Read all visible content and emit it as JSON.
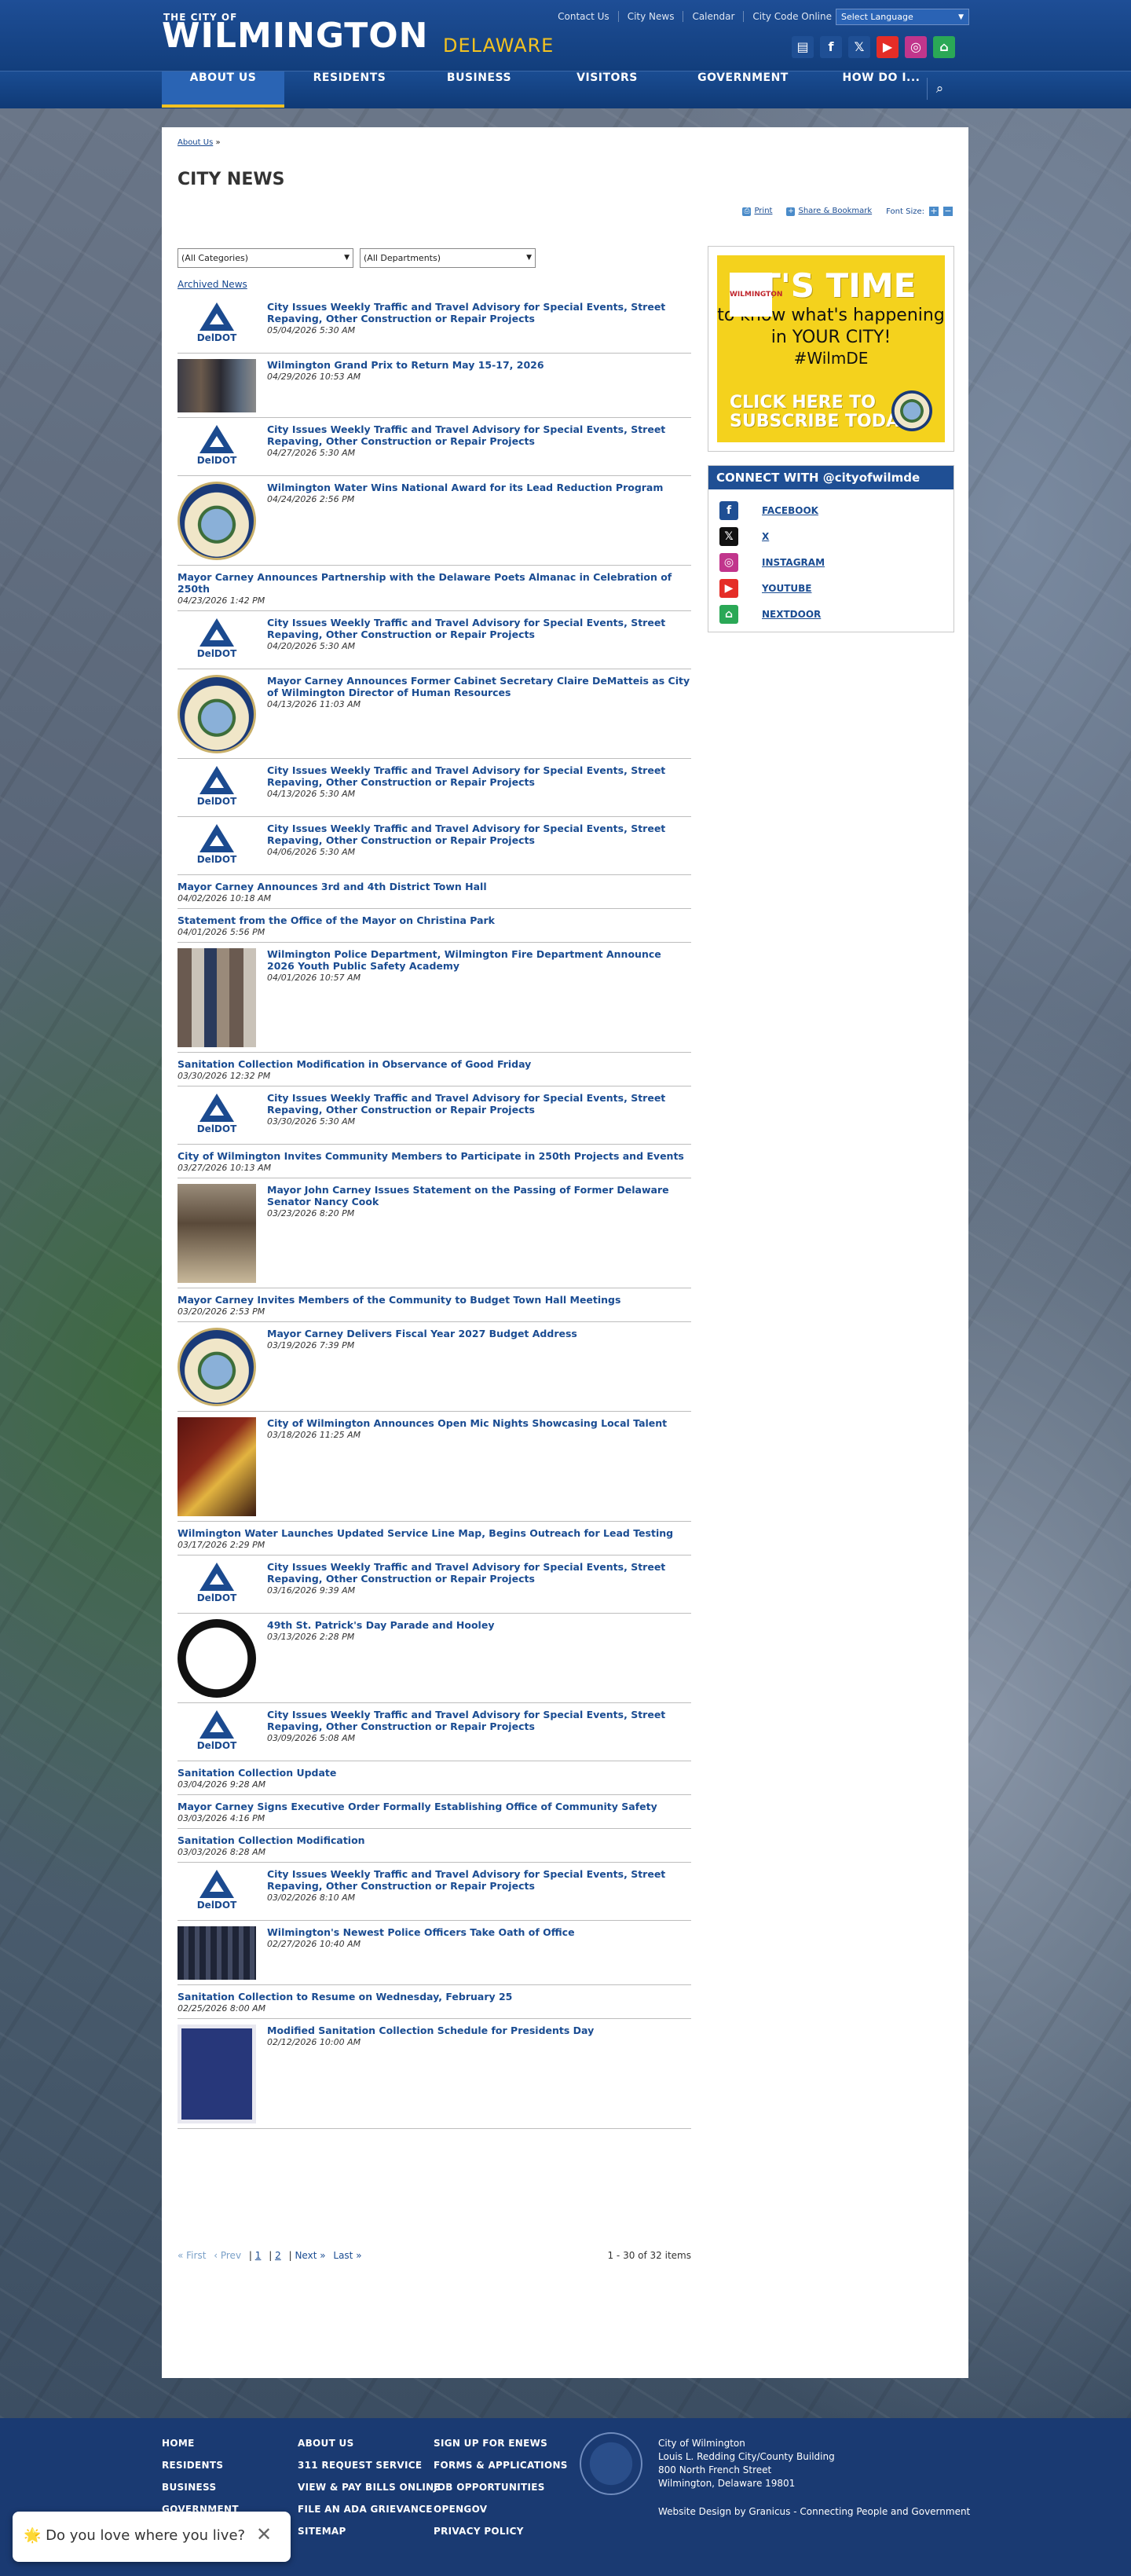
{
  "header": {
    "logo_small": "THE CITY OF",
    "logo_big": "WILMINGTON",
    "logo_state": "DELAWARE",
    "top_links": [
      "Contact Us",
      "City News",
      "Calendar",
      "City Code Online"
    ],
    "language": "Select Language",
    "social": [
      {
        "name": "news-icon",
        "glyph": "▤",
        "color": "#1f4f94"
      },
      {
        "name": "facebook-icon",
        "glyph": "f",
        "color": "#1f4f94"
      },
      {
        "name": "x-icon",
        "glyph": "𝕏",
        "color": "#1f4f94"
      },
      {
        "name": "youtube-icon",
        "glyph": "▶",
        "color": "#e52d27"
      },
      {
        "name": "instagram-icon",
        "glyph": "◎",
        "color": "#c1358c"
      },
      {
        "name": "nextdoor-icon",
        "glyph": "⌂",
        "color": "#2aa856"
      }
    ]
  },
  "nav": {
    "items": [
      "ABOUT US",
      "RESIDENTS",
      "BUSINESS",
      "VISITORS",
      "GOVERNMENT",
      "HOW DO I..."
    ],
    "active": "ABOUT US",
    "search_icon": "search-icon"
  },
  "breadcrumb": {
    "root": "About Us",
    "sep": "»"
  },
  "page_title": "CITY NEWS",
  "tools": {
    "print": "Print",
    "share": "Share & Bookmark",
    "font_size": "Font Size:",
    "plus": "+",
    "minus": "−"
  },
  "filters": {
    "category": "(All Categories)",
    "department": "(All Departments)"
  },
  "archived": "Archived News",
  "news": [
    {
      "title": "City Issues Weekly Traffic and Travel Advisory for Special Events, Street Repaving, Other Construction or Repair Projects",
      "date": "05/04/2026 5:30 AM",
      "thumb": "deldot"
    },
    {
      "title": "Wilmington Grand Prix to Return May 15-17, 2026",
      "date": "04/29/2026 10:53 AM",
      "thumb": "photo-a"
    },
    {
      "title": "City Issues Weekly Traffic and Travel Advisory for Special Events, Street Repaving, Other Construction or Repair Projects",
      "date": "04/27/2026 5:30 AM",
      "thumb": "deldot"
    },
    {
      "title": "Wilmington Water Wins National Award for its Lead Reduction Program",
      "date": "04/24/2026 2:56 PM",
      "thumb": "seal"
    },
    {
      "title": "Mayor Carney Announces Partnership with the Delaware Poets Almanac in Celebration of 250th",
      "date": "04/23/2026 1:42 PM",
      "thumb": ""
    },
    {
      "title": "City Issues Weekly Traffic and Travel Advisory for Special Events, Street Repaving, Other Construction or Repair Projects",
      "date": "04/20/2026 5:30 AM",
      "thumb": "deldot"
    },
    {
      "title": "Mayor Carney Announces Former Cabinet Secretary Claire DeMatteis as City of Wilmington Director of Human Resources",
      "date": "04/13/2026 11:03 AM",
      "thumb": "seal"
    },
    {
      "title": "City Issues Weekly Traffic and Travel Advisory for Special Events, Street Repaving, Other Construction or Repair Projects",
      "date": "04/13/2026 5:30 AM",
      "thumb": "deldot"
    },
    {
      "title": "City Issues Weekly Traffic and Travel Advisory for Special Events, Street Repaving, Other Construction or Repair Projects",
      "date": "04/06/2026 5:30 AM",
      "thumb": "deldot"
    },
    {
      "title": "Mayor Carney Announces 3rd and 4th District Town Hall",
      "date": "04/02/2026 10:18 AM",
      "thumb": ""
    },
    {
      "title": "Statement from the Office of the Mayor on Christina Park",
      "date": "04/01/2026 5:56 PM",
      "thumb": ""
    },
    {
      "title": "Wilmington Police Department, Wilmington Fire Department Announce 2026 Youth Public Safety Academy",
      "date": "04/01/2026 10:57 AM",
      "thumb": "photo-b"
    },
    {
      "title": "Sanitation Collection Modification in Observance of Good Friday",
      "date": "03/30/2026 12:32 PM",
      "thumb": ""
    },
    {
      "title": "City Issues Weekly Traffic and Travel Advisory for Special Events, Street Repaving, Other Construction or Repair Projects",
      "date": "03/30/2026 5:30 AM",
      "thumb": "deldot"
    },
    {
      "title": "City of Wilmington Invites Community Members to Participate in 250th Projects and Events",
      "date": "03/27/2026 10:13 AM",
      "thumb": ""
    },
    {
      "title": "Mayor John Carney Issues Statement on the Passing of Former Delaware Senator Nancy Cook",
      "date": "03/23/2026 8:20 PM",
      "thumb": "photo-c"
    },
    {
      "title": "Mayor Carney Invites Members of the Community to Budget Town Hall Meetings",
      "date": "03/20/2026 2:53 PM",
      "thumb": ""
    },
    {
      "title": "Mayor Carney Delivers Fiscal Year 2027 Budget Address",
      "date": "03/19/2026 7:39 PM",
      "thumb": "seal"
    },
    {
      "title": "City of Wilmington Announces Open Mic Nights Showcasing Local Talent",
      "date": "03/18/2026 11:25 AM",
      "thumb": "photo-d"
    },
    {
      "title": "Wilmington Water Launches Updated Service Line Map, Begins Outreach for Lead Testing",
      "date": "03/17/2026 2:29 PM",
      "thumb": ""
    },
    {
      "title": "City Issues Weekly Traffic and Travel Advisory for Special Events, Street Repaving, Other Construction or Repair Projects",
      "date": "03/16/2026 9:39 AM",
      "thumb": "deldot"
    },
    {
      "title": "49th St. Patrick's Day Parade and Hooley",
      "date": "03/13/2026 2:28 PM",
      "thumb": "shamrock"
    },
    {
      "title": "City Issues Weekly Traffic and Travel Advisory for Special Events, Street Repaving, Other Construction or Repair Projects",
      "date": "03/09/2026 5:08 AM",
      "thumb": "deldot"
    },
    {
      "title": "Sanitation Collection Update",
      "date": "03/04/2026 9:28 AM",
      "thumb": ""
    },
    {
      "title": "Mayor Carney Signs Executive Order Formally Establishing Office of Community Safety",
      "date": "03/03/2026 4:16 PM",
      "thumb": ""
    },
    {
      "title": "Sanitation Collection Modification",
      "date": "03/03/2026 8:28 AM",
      "thumb": ""
    },
    {
      "title": "City Issues Weekly Traffic and Travel Advisory for Special Events, Street Repaving, Other Construction or Repair Projects",
      "date": "03/02/2026 8:10 AM",
      "thumb": "deldot"
    },
    {
      "title": "Wilmington's Newest Police Officers Take Oath of Office",
      "date": "02/27/2026 10:40 AM",
      "thumb": "photo-e"
    },
    {
      "title": "Sanitation Collection to Resume on Wednesday, February 25",
      "date": "02/25/2026 8:00 AM",
      "thumb": ""
    },
    {
      "title": "Modified Sanitation Collection Schedule for Presidents Day",
      "date": "02/12/2026 10:00 AM",
      "thumb": "photo-f"
    }
  ],
  "deldot_label": "DelDOT",
  "pager": {
    "first": "« First",
    "prev": "‹ Prev",
    "pages": [
      "1",
      "2"
    ],
    "next": "Next »",
    "last": "Last »",
    "count": "1 - 30 of 32 items"
  },
  "banner": {
    "wilm": "WILMINGTON",
    "big": "IT'S TIME",
    "l2a": "to know what's happening",
    "l2b": "in YOUR CITY!",
    "l3": "#WilmDE",
    "cta1": "CLICK HERE TO",
    "cta2": "SUBSCRIBE TODAY",
    "color": "#f4d21d"
  },
  "connect": {
    "title": "CONNECT WITH @cityofwilmde",
    "items": [
      {
        "label": "FACEBOOK",
        "icon": "facebook-icon",
        "glyph": "f",
        "color": "#1f4f94"
      },
      {
        "label": "X",
        "icon": "x-icon",
        "glyph": "𝕏",
        "color": "#111"
      },
      {
        "label": "INSTAGRAM",
        "icon": "instagram-icon",
        "glyph": "◎",
        "color": "#c1358c"
      },
      {
        "label": "YOUTUBE",
        "icon": "youtube-icon",
        "glyph": "▶",
        "color": "#e52d27"
      },
      {
        "label": "NEXTDOOR",
        "icon": "nextdoor-icon",
        "glyph": "⌂",
        "color": "#2aa856"
      }
    ]
  },
  "footer": {
    "col1": [
      "HOME",
      "RESIDENTS",
      "BUSINESS",
      "GOVERNMENT"
    ],
    "col2": [
      "ABOUT US",
      "311 REQUEST SERVICE",
      "VIEW & PAY BILLS ONLINE",
      "FILE AN ADA GRIEVANCE",
      "SITEMAP"
    ],
    "col3": [
      "SIGN UP FOR ENEWS",
      "FORMS & APPLICATIONS",
      "JOB OPPORTUNITIES",
      "OPENGOV",
      "PRIVACY POLICY"
    ],
    "addr": [
      "City of Wilmington",
      "Louis L. Redding City/County Building",
      "800 North French Street",
      "Wilmington, Delaware 19801"
    ],
    "credit": "Website Design by Granicus - Connecting People and Government"
  },
  "toast": {
    "text": "🌟 Do you love where you live?",
    "close": "✕"
  }
}
